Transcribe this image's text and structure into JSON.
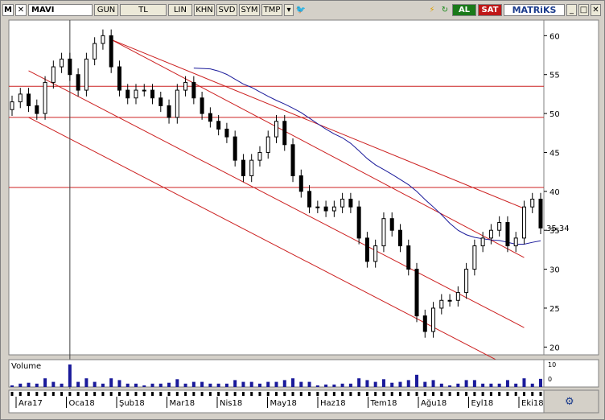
{
  "toolbar": {
    "logo": "M",
    "symbol": "MAVI",
    "period": "GUN",
    "currency": "TL",
    "scale": "LIN",
    "buttons": [
      "KHN",
      "SVD",
      "SYM",
      "TMP"
    ],
    "buy": "AL",
    "sell": "SAT",
    "brand": "MATRiKS"
  },
  "colors": {
    "candle": "#000000",
    "channel": "#cc2020",
    "ma": "#1a1a9a",
    "volume": "#1a1a9a",
    "background": "#ffffff"
  },
  "chart_data": {
    "type": "candlestick",
    "ylim": [
      19,
      62
    ],
    "yticks": [
      60,
      55,
      50,
      45,
      40,
      35,
      30,
      25,
      20
    ],
    "last_price_label": "35,34",
    "last_price": 35.34,
    "x_labels": [
      "Ara17",
      "Oca18",
      "Şub18",
      "Mar18",
      "Nis18",
      "May18",
      "Haz18",
      "Tem18",
      "Ağu18",
      "Eyl18",
      "Eki18"
    ],
    "horizontal_levels": [
      53.5,
      49.5,
      40.5
    ],
    "channel_lines": [
      {
        "from": [
          2,
          49.5
        ],
        "to": [
          62,
          16.5
        ]
      },
      {
        "from": [
          2,
          55.5
        ],
        "to": [
          62,
          22.5
        ]
      },
      {
        "from": [
          12,
          59.5
        ],
        "to": [
          62,
          31.5
        ]
      },
      {
        "from": [
          12,
          59.5
        ],
        "to": [
          62,
          37.8
        ]
      }
    ],
    "volume_label": "Volume",
    "volume_axis_labels": [
      "10",
      "0"
    ],
    "close": [
      51.5,
      52.5,
      51,
      50,
      54,
      56,
      57,
      55,
      53,
      57,
      59,
      60,
      56,
      53,
      52,
      53,
      53,
      52,
      51,
      49.5,
      53,
      54,
      52,
      50,
      49,
      48,
      47,
      44,
      42,
      44,
      45,
      47,
      49,
      46,
      42,
      40,
      38,
      38,
      37.5,
      38,
      39,
      38,
      34,
      31,
      33,
      36.5,
      35,
      33,
      30,
      24,
      22,
      25,
      26,
      26,
      27,
      30,
      33,
      34,
      35,
      36,
      33,
      34,
      38,
      39,
      35.3
    ]
  }
}
